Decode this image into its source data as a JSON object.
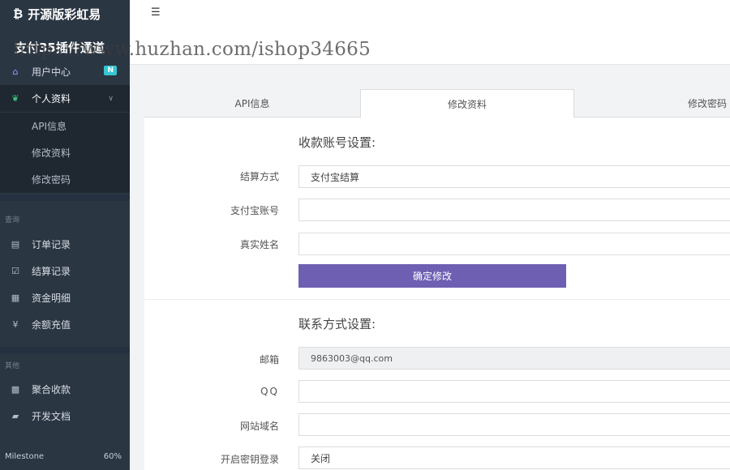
{
  "sidebar": {
    "brand": "开源版彩虹易",
    "brand_sub": "支付35插件通道",
    "items": [
      {
        "label": "用户中心",
        "badge": "N"
      },
      {
        "label": "个人资料"
      }
    ],
    "subitems": [
      "API信息",
      "修改资料",
      "修改密码"
    ],
    "section_query": "查询",
    "query_items": [
      "订单记录",
      "结算记录",
      "资金明细",
      "余额充值"
    ],
    "section_other": "其他",
    "other_items": [
      "聚合收款",
      "开发文档"
    ],
    "milestone_label": "Milestone",
    "milestone_value": "60%"
  },
  "header": {
    "watermark": "https://www.huzhan.com/ishop34665"
  },
  "tabs": [
    "API信息",
    "修改资料",
    "修改密码"
  ],
  "form": {
    "payment_title": "收款账号设置:",
    "settle_label": "结算方式",
    "settle_value": "支付宝结算",
    "alipay_label": "支付宝账号",
    "alipay_value": "",
    "realname_label": "真实姓名",
    "realname_value": "",
    "submit_label": "确定修改",
    "contact_title": "联系方式设置:",
    "email_label": "邮箱",
    "email_value": "9863003@qq.com",
    "qq_label": "QQ",
    "qq_value": "",
    "domain_label": "网站域名",
    "domain_value": "",
    "keylogin_label": "开启密钥登录",
    "keylogin_value": "关闭"
  }
}
